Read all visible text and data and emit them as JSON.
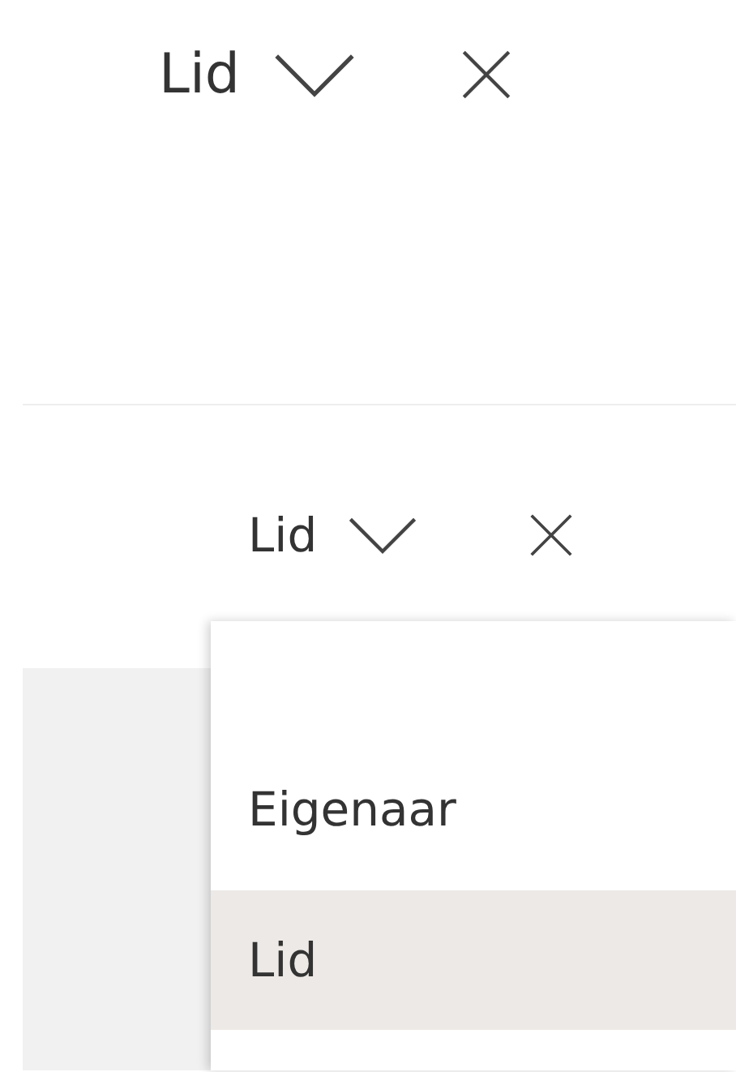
{
  "top_row": {
    "role": "Lid"
  },
  "panel": {
    "role": "Lid",
    "options": [
      {
        "label": "Eigenaar",
        "selected": false
      },
      {
        "label": "Lid",
        "selected": true
      }
    ]
  }
}
